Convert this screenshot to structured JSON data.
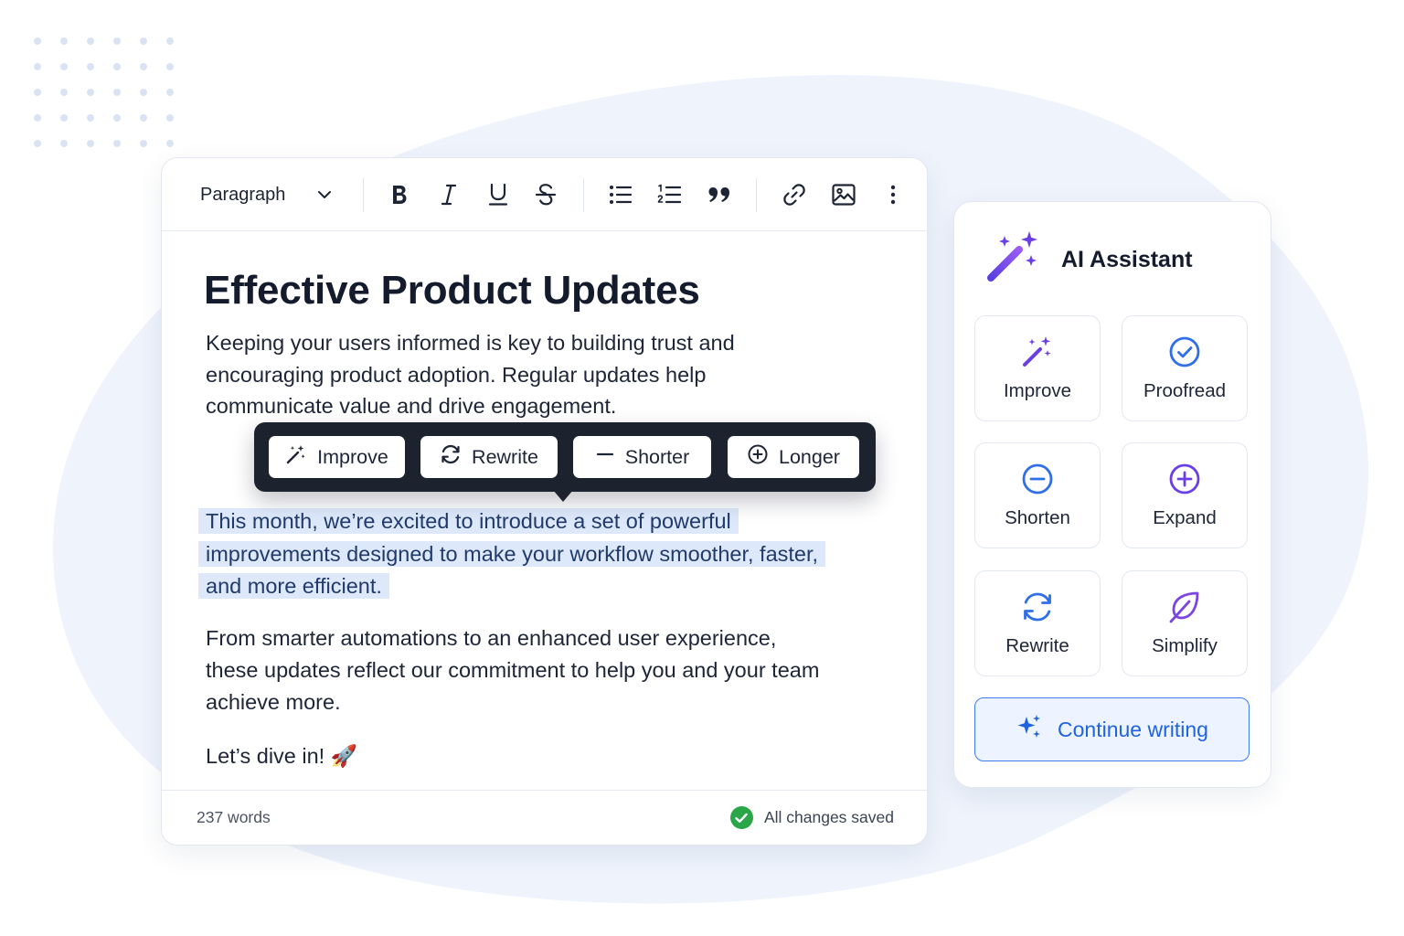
{
  "colors": {
    "accent_blue": "#2f6fe8",
    "accent_purple": "#6b3fe3",
    "highlight": "#dde9fb",
    "bubble_bg": "#1c222e",
    "success_green": "#2aa648"
  },
  "toolbar": {
    "block_type": "Paragraph",
    "icons": [
      "chevron-down-icon",
      "bold-icon",
      "italic-icon",
      "underline-icon",
      "strikethrough-icon",
      "bullet-list-icon",
      "numbered-list-icon",
      "quote-icon",
      "link-icon",
      "image-icon",
      "more-vertical-icon"
    ]
  },
  "document": {
    "title": "Effective Product Updates",
    "paragraphs": [
      "Keeping your users informed is key to building trust and encouraging product adoption. Regular updates help communicate value and drive engagement.",
      "This month, we’re excited to introduce a set of powerful improvements designed to make your workflow smoother, faster, and more efficient.",
      "From smarter automations to an enhanced user experience, these updates reflect our commitment to help you and your team achieve more.",
      "Let’s dive in! 🚀"
    ]
  },
  "bubble_menu": {
    "improve": "Improve",
    "rewrite": "Rewrite",
    "shorter": "Shorter",
    "longer": "Longer"
  },
  "footer": {
    "word_count": "237 words",
    "save_status": "All changes saved"
  },
  "assistant": {
    "title": "AI Assistant",
    "actions": {
      "improve": "Improve",
      "proofread": "Proofread",
      "shorten": "Shorten",
      "expand": "Expand",
      "rewrite": "Rewrite",
      "simplify": "Simplify"
    },
    "continue_label": "Continue writing"
  }
}
